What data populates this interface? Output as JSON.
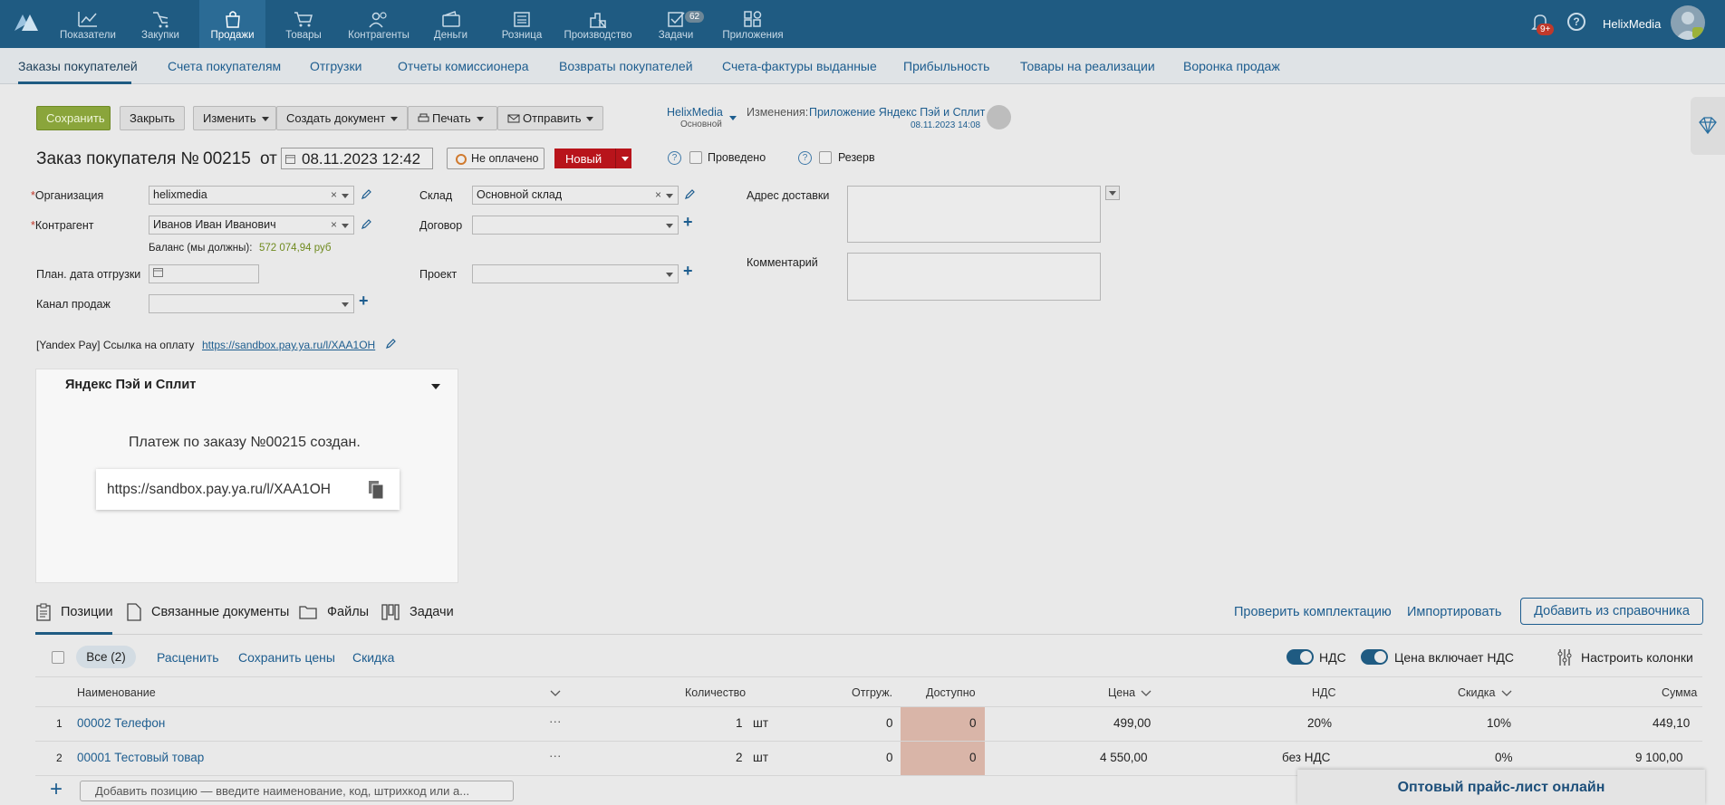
{
  "topnav": {
    "items": [
      {
        "label": "Показатели"
      },
      {
        "label": "Закупки"
      },
      {
        "label": "Продажи"
      },
      {
        "label": "Товары"
      },
      {
        "label": "Контрагенты"
      },
      {
        "label": "Деньги"
      },
      {
        "label": "Розница"
      },
      {
        "label": "Производство"
      },
      {
        "label": "Задачи",
        "badge": "62"
      },
      {
        "label": "Приложения"
      }
    ],
    "notifications_badge": "9+",
    "help": "?",
    "user_name": "HelixMedia"
  },
  "subnav": {
    "items": [
      "Заказы покупателей",
      "Счета покупателям",
      "Отгрузки",
      "Отчеты комиссионера",
      "Возвраты покупателей",
      "Счета-фактуры выданные",
      "Прибыльность",
      "Товары на реализации",
      "Воронка продаж"
    ]
  },
  "toolbar": {
    "save": "Сохранить",
    "close": "Закрыть",
    "change": "Изменить",
    "create_doc": "Создать документ",
    "print": "Печать",
    "send": "Отправить",
    "owner": "HelixMedia",
    "owner_sub": "Основной",
    "changes_label": "Изменения:",
    "changes_app": "Приложение Яндекс Пэй и Сплит",
    "changes_date": "08.11.2023 14:08"
  },
  "order": {
    "title": "Заказ покупателя №",
    "number": "00215",
    "from": "от",
    "date": "08.11.2023 12:42",
    "payment_status": "Не оплачено",
    "status": "Новый",
    "conducted": "Проведено",
    "reserve": "Резерв"
  },
  "form": {
    "org_label": "Организация",
    "org_value": "helixmedia",
    "counterparty_label": "Контрагент",
    "counterparty_value": "Иванов Иван Иванович",
    "balance_label": "Баланс (мы должны):",
    "balance_value": "572 074,94 руб",
    "ship_date_label": "План. дата отгрузки",
    "channel_label": "Канал продаж",
    "warehouse_label": "Склад",
    "warehouse_value": "Основной склад",
    "contract_label": "Договор",
    "project_label": "Проект",
    "address_label": "Адрес доставки",
    "comment_label": "Комментарий",
    "yandex_label": "[Yandex Pay] Ссылка на оплату",
    "yandex_link": "https://sandbox.pay.ya.ru/l/XAA1OH"
  },
  "widget": {
    "title": "Яндекс Пэй и Сплит",
    "message": "Платеж по заказу №00215 создан.",
    "link": "https://sandbox.pay.ya.ru/l/XAA1OH"
  },
  "tabs": {
    "positions": "Позиции",
    "related": "Связанные документы",
    "files": "Файлы",
    "tasks": "Задачи",
    "check": "Проверить комплектацию",
    "import": "Импортировать",
    "add_from": "Добавить из справочника"
  },
  "table_toolbar": {
    "all": "Все (2)",
    "reprice": "Расценить",
    "save_prices": "Сохранить цены",
    "discount": "Скидка",
    "vat": "НДС",
    "price_incl_vat": "Цена включает НДС",
    "columns": "Настроить колонки"
  },
  "table": {
    "headers": {
      "name": "Наименование",
      "qty": "Количество",
      "shipped": "Отгруж.",
      "available": "Доступно",
      "price": "Цена",
      "vat": "НДС",
      "discount": "Скидка",
      "sum": "Сумма"
    },
    "rows": [
      {
        "n": "1",
        "name": "00002 Телефон",
        "more": "···",
        "qty": "1",
        "unit": "шт",
        "shipped": "0",
        "available": "0",
        "price": "499,00",
        "vat": "20%",
        "discount": "10%",
        "sum": "449,10"
      },
      {
        "n": "2",
        "name": "00001 Тестовый товар",
        "more": "···",
        "qty": "2",
        "unit": "шт",
        "shipped": "0",
        "available": "0",
        "price": "4 550,00",
        "vat": "без НДС",
        "discount": "0%",
        "sum": "9 100,00"
      }
    ],
    "add_placeholder": "Добавить позицию — введите наименование, код, штрихкод или а..."
  },
  "promo": "Оптовый прайс-лист онлайн"
}
